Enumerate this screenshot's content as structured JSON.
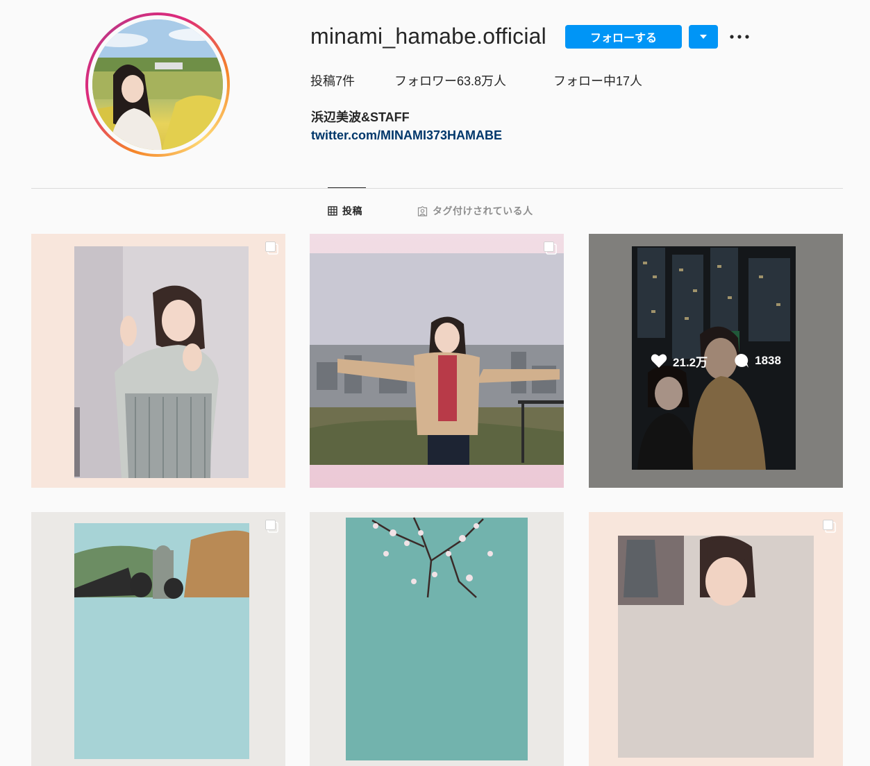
{
  "profile": {
    "username": "minami_hamabe.official",
    "follow_label": "フォローする",
    "dropdown_icon": "chevron-down-icon",
    "more_icon": "ellipsis-icon",
    "stats": {
      "posts_prefix": "投稿",
      "posts_count": "7",
      "posts_suffix": "件",
      "followers_prefix": "フォロワー",
      "followers_count": "63.8万",
      "followers_suffix": "人",
      "following_prefix": "フォロー中",
      "following_count": "17",
      "following_suffix": "人"
    },
    "full_name": "浜辺美波&STAFF",
    "bio_link": "twitter.com/MINAMI373HAMABE"
  },
  "tabs": {
    "posts_label": "投稿",
    "tagged_label": "タグ付けされている人"
  },
  "posts": [
    {
      "multi": true
    },
    {
      "multi": true
    },
    {
      "multi": false,
      "hover": {
        "likes": "21.2万",
        "comments": "1838"
      }
    },
    {
      "multi": true
    },
    {
      "multi": false
    },
    {
      "multi": true
    }
  ],
  "colors": {
    "accent": "#0095f6",
    "link": "#00376b",
    "text": "#262626",
    "muted": "#8e8e8e",
    "background": "#fafafa"
  }
}
